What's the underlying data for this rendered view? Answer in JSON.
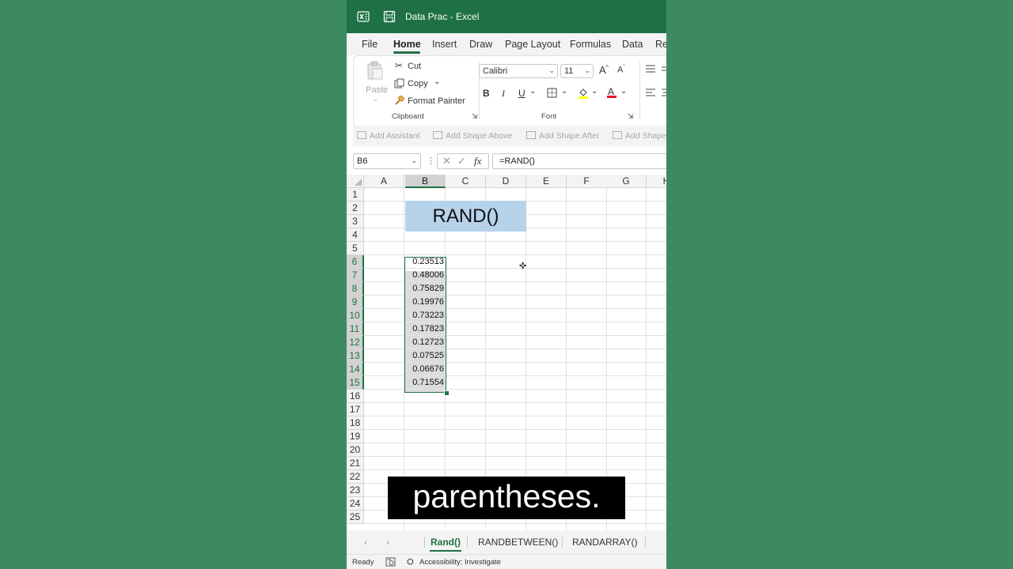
{
  "window": {
    "title": "Data Prac  -  Excel"
  },
  "ribbon_tabs": [
    "File",
    "Home",
    "Insert",
    "Draw",
    "Page Layout",
    "Formulas",
    "Data",
    "Re"
  ],
  "clipboard": {
    "paste": "Paste",
    "cut": "Cut",
    "copy": "Copy",
    "format_painter": "Format Painter",
    "group_label": "Clipboard"
  },
  "font": {
    "name": "Calibri",
    "size": "11",
    "bold": "B",
    "italic": "I",
    "underline": "U",
    "group_label": "Font"
  },
  "smartart": {
    "add_assistant": "Add Assistant",
    "add_shape_above": "Add Shape Above",
    "add_shape_after": "Add Shape After",
    "add_shape": "Add Shape"
  },
  "formula_bar": {
    "name_box": "B6",
    "fx": "fx",
    "formula": "=RAND()"
  },
  "columns": [
    "A",
    "B",
    "C",
    "D",
    "E",
    "F",
    "G",
    "H"
  ],
  "rows": [
    "1",
    "2",
    "3",
    "4",
    "5",
    "6",
    "7",
    "8",
    "9",
    "10",
    "11",
    "12",
    "13",
    "14",
    "15",
    "16",
    "17",
    "18",
    "19",
    "20",
    "21",
    "22",
    "23",
    "24",
    "25"
  ],
  "sheet": {
    "title_cell": "RAND()",
    "values": [
      "0.23513",
      "0.48006",
      "0.75829",
      "0.19976",
      "0.73223",
      "0.17823",
      "0.12723",
      "0.07525",
      "0.06676",
      "0.71554"
    ]
  },
  "sheet_tabs": [
    "Rand()",
    "RANDBETWEEN()",
    "RANDARRAY()"
  ],
  "status": {
    "ready": "Ready",
    "accessibility": "Accessibility: Investigate"
  },
  "caption": "parentheses.",
  "colors": {
    "excel_green": "#1e7145",
    "background": "#3e8a5f",
    "title_fill": "#b6d3ea"
  }
}
